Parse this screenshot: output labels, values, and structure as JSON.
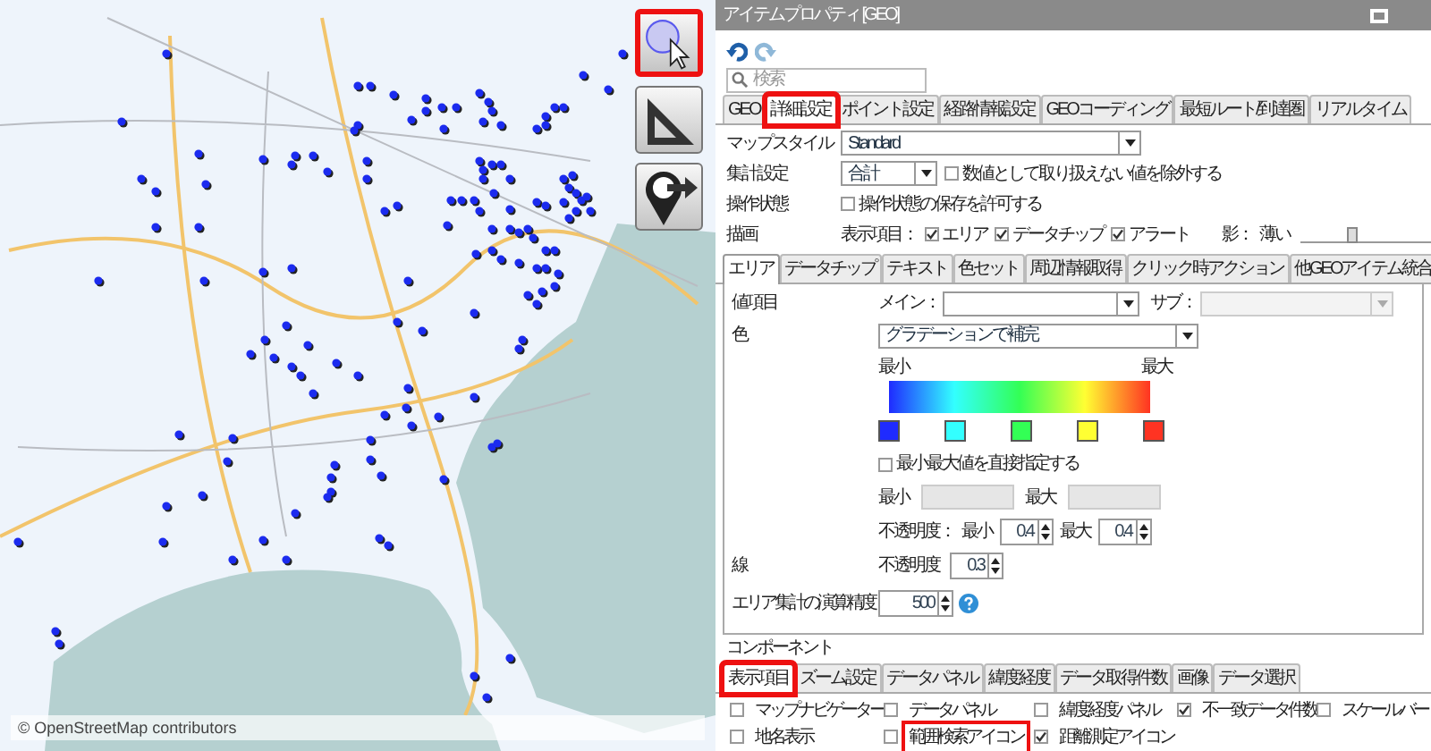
{
  "map": {
    "attribution": "© OpenStreetMap contributors",
    "tools": [
      {
        "kind": "range-search",
        "highlighted": true
      },
      {
        "kind": "measure",
        "highlighted": false
      },
      {
        "kind": "route",
        "highlighted": false
      }
    ]
  },
  "panel": {
    "title": "アイテムプロパティ [GEO]",
    "search": {
      "placeholder": "検索"
    },
    "tabs": [
      {
        "label": "GEO",
        "selected": false,
        "highlighted": false
      },
      {
        "label": "詳細設定",
        "selected": true,
        "highlighted": true
      },
      {
        "label": "ポイント設定",
        "selected": false,
        "highlighted": false
      },
      {
        "label": "経路情報設定",
        "selected": false,
        "highlighted": false
      },
      {
        "label": "GEOコーディング",
        "selected": false,
        "highlighted": false
      },
      {
        "label": "最短ルート/到達圏",
        "selected": false,
        "highlighted": false
      },
      {
        "label": "リアルタイム",
        "selected": false,
        "highlighted": false
      }
    ],
    "map_style": {
      "label": "マップスタイル",
      "value": "Standard"
    },
    "aggregation": {
      "label": "集計設定",
      "value": "合計",
      "option": {
        "label": "数値として取り扱えない値を除外する",
        "checked": false
      }
    },
    "operation": {
      "label": "操作状態",
      "option": {
        "label": "操作状態の保存を許可する",
        "checked": false
      }
    },
    "drawing": {
      "label": "描画",
      "items_label": "表示項目：",
      "items": [
        {
          "label": "エリア",
          "checked": true
        },
        {
          "label": "データチップ",
          "checked": true
        },
        {
          "label": "アラート",
          "checked": true
        }
      ],
      "shadow": {
        "label": "影：",
        "value": "薄い",
        "level": 0.4
      }
    },
    "sub_tabs": [
      {
        "label": "エリア",
        "selected": true
      },
      {
        "label": "データチップ",
        "selected": false
      },
      {
        "label": "テキスト",
        "selected": false
      },
      {
        "label": "色セット",
        "selected": false
      },
      {
        "label": "周辺情報取得",
        "selected": false
      },
      {
        "label": "クリック時アクション",
        "selected": false
      },
      {
        "label": "他GEOアイテム統合",
        "selected": false
      }
    ],
    "value_item": {
      "label": "値項目",
      "main_label": "メイン：",
      "sub_label": "サブ："
    },
    "color": {
      "label": "色",
      "value": "グラデーションで補完",
      "min_label": "最小",
      "max_label": "最大",
      "swatches": [
        {
          "color": "#1f2bff"
        },
        {
          "color": "#33ffff"
        },
        {
          "color": "#33ff55"
        },
        {
          "color": "#ffff33"
        },
        {
          "color": "#ff3322"
        }
      ],
      "direct": {
        "label": "最小最大値を直接指定する",
        "checked": false
      },
      "min_field_label": "最小",
      "max_field_label": "最大",
      "opacity_label": "不透明度：",
      "opacity_min_label": "最小",
      "opacity_min": "0.4",
      "opacity_max_label": "最大",
      "opacity_max": "0.4"
    },
    "line": {
      "label": "線",
      "opacity_label": "不透明度",
      "opacity": "0.3"
    },
    "precision": {
      "label": "エリア集計の演算精度",
      "value": "500"
    },
    "component": {
      "label": "コンポーネント",
      "tabs": [
        {
          "label": "表示項目",
          "selected": true,
          "highlighted": true
        },
        {
          "label": "ズーム設定",
          "selected": false,
          "highlighted": false
        },
        {
          "label": "データパネル",
          "selected": false,
          "highlighted": false
        },
        {
          "label": "緯度経度",
          "selected": false,
          "highlighted": false
        },
        {
          "label": "データ取得件数",
          "selected": false,
          "highlighted": false
        },
        {
          "label": "画像",
          "selected": false,
          "highlighted": false
        },
        {
          "label": "データ選択",
          "selected": false,
          "highlighted": false
        }
      ],
      "options": [
        [
          {
            "label": "マップナビゲーター",
            "checked": false,
            "highlighted": false
          },
          {
            "label": "データパネル",
            "checked": false,
            "highlighted": false
          },
          {
            "label": "緯度経度パネル",
            "checked": false,
            "highlighted": false
          },
          {
            "label": "不一致データ件数",
            "checked": true,
            "highlighted": false
          },
          {
            "label": "スケールバー",
            "checked": false,
            "highlighted": false
          }
        ],
        [
          {
            "label": "地名表示",
            "checked": false,
            "highlighted": false
          },
          {
            "label": "範囲検索アイコン",
            "checked": false,
            "highlighted": true
          },
          {
            "label": "距離測定アイコン",
            "checked": true,
            "highlighted": false
          }
        ]
      ]
    }
  }
}
